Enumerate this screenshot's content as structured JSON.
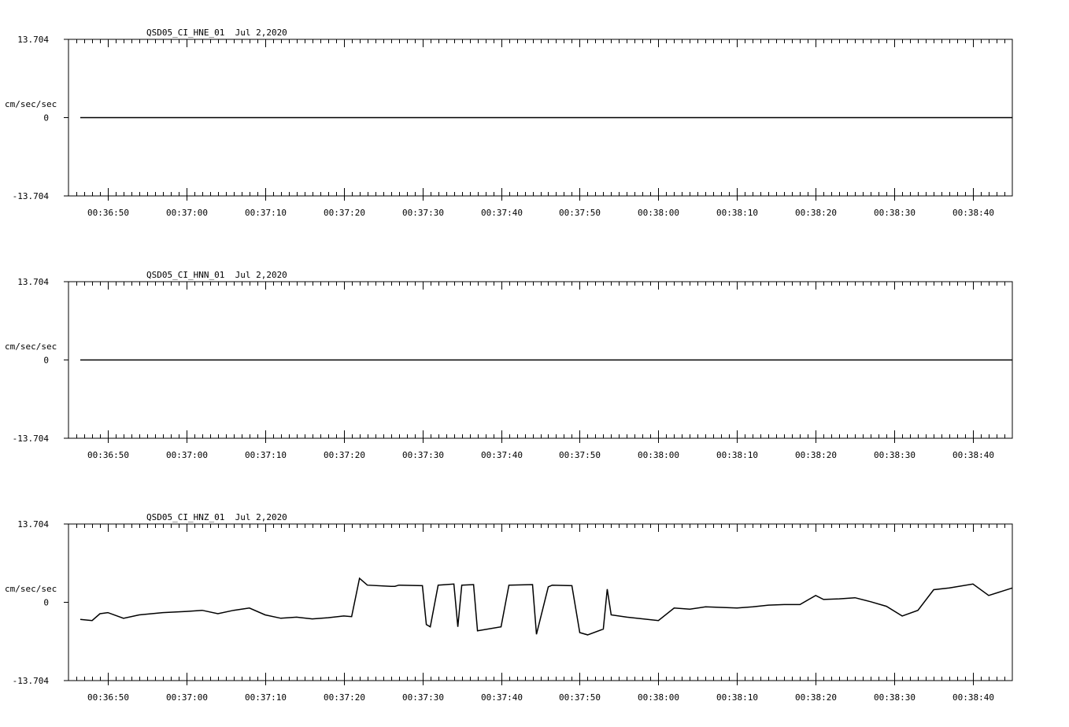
{
  "chart_data": [
    {
      "type": "line",
      "title": "QSD05_CI_HNE_01  Jul 2,2020",
      "ylabel": "cm/sec/sec",
      "ytick_labels": [
        "13.704",
        "0",
        "-13.704"
      ],
      "ylim": [
        -13.704,
        13.704
      ],
      "x_start": "00:36:45",
      "x_end": "00:38:45",
      "xtick_labels": [
        "00:36:50",
        "00:37:00",
        "00:37:10",
        "00:37:20",
        "00:37:30",
        "00:37:40",
        "00:37:50",
        "00:38:00",
        "00:38:10",
        "00:38:20",
        "00:38:30",
        "00:38:40"
      ],
      "series": [
        {
          "x": [
            "00:36:46.5",
            "00:38:45"
          ],
          "y": [
            0,
            0
          ]
        }
      ]
    },
    {
      "type": "line",
      "title": "QSD05_CI_HNN_01  Jul 2,2020",
      "ylabel": "cm/sec/sec",
      "ytick_labels": [
        "13.704",
        "0",
        "-13.704"
      ],
      "ylim": [
        -13.704,
        13.704
      ],
      "x_start": "00:36:45",
      "x_end": "00:38:45",
      "xtick_labels": [
        "00:36:50",
        "00:37:00",
        "00:37:10",
        "00:37:20",
        "00:37:30",
        "00:37:40",
        "00:37:50",
        "00:38:00",
        "00:38:10",
        "00:38:20",
        "00:38:30",
        "00:38:40"
      ],
      "series": [
        {
          "x": [
            "00:36:46.5",
            "00:38:45"
          ],
          "y": [
            0,
            0
          ]
        }
      ]
    },
    {
      "type": "line",
      "title": "QSD05_CI_HNZ_01  Jul 2,2020",
      "ylabel": "cm/sec/sec",
      "ytick_labels": [
        "13.704",
        "0",
        "-13.704"
      ],
      "ylim": [
        -13.704,
        13.704
      ],
      "x_start": "00:36:45",
      "x_end": "00:38:45",
      "xtick_labels": [
        "00:36:50",
        "00:37:00",
        "00:37:10",
        "00:37:20",
        "00:37:30",
        "00:37:40",
        "00:37:50",
        "00:38:00",
        "00:38:10",
        "00:38:20",
        "00:38:30",
        "00:38:40"
      ],
      "series": [
        {
          "x": [
            "00:36:46.5",
            "00:36:48",
            "00:36:49",
            "00:36:50",
            "00:36:52",
            "00:36:54",
            "00:36:57",
            "00:37:00",
            "00:37:02",
            "00:37:04",
            "00:37:06",
            "00:37:08",
            "00:37:10",
            "00:37:12",
            "00:37:14",
            "00:37:16",
            "00:37:18",
            "00:37:20",
            "00:37:21",
            "00:37:22",
            "00:37:23",
            "00:37:26",
            "00:37:26.5",
            "00:37:27",
            "00:37:30",
            "00:37:30.5",
            "00:37:31",
            "00:37:32",
            "00:37:34",
            "00:37:34.5",
            "00:37:35",
            "00:37:36.5",
            "00:37:37",
            "00:37:40",
            "00:37:41",
            "00:37:44",
            "00:37:44.5",
            "00:37:46",
            "00:37:46.5",
            "00:37:49",
            "00:37:50",
            "00:37:51",
            "00:37:53",
            "00:37:53.5",
            "00:37:54",
            "00:37:56",
            "00:38:00",
            "00:38:02",
            "00:38:04",
            "00:38:06",
            "00:38:08",
            "00:38:10",
            "00:38:12",
            "00:38:14",
            "00:38:16",
            "00:38:18",
            "00:38:20",
            "00:38:21",
            "00:38:23",
            "00:38:25",
            "00:38:27",
            "00:38:29",
            "00:38:31",
            "00:38:33",
            "00:38:35",
            "00:38:37",
            "00:38:40",
            "00:38:42",
            "00:38:45"
          ],
          "y": [
            -3,
            -3.2,
            -2,
            -1.8,
            -2.8,
            -2.2,
            -1.8,
            -1.6,
            -1.4,
            -2,
            -1.4,
            -1,
            -2.2,
            -2.8,
            -2.6,
            -2.9,
            -2.7,
            -2.4,
            -2.5,
            4.2,
            3,
            2.8,
            2.8,
            3,
            2.9,
            -3.9,
            -4.3,
            3,
            3.2,
            -4.3,
            3,
            3.1,
            -5,
            -4.3,
            3,
            3.1,
            -5.6,
            2.7,
            3,
            2.9,
            -5.3,
            -5.7,
            -4.7,
            2.3,
            -2.2,
            -2.6,
            -3.2,
            -1,
            -1.2,
            -0.8,
            -0.9,
            -1,
            -0.8,
            -0.5,
            -0.4,
            -0.4,
            1.2,
            0.5,
            0.6,
            0.8,
            0.1,
            -0.7,
            -2.4,
            -1.4,
            2.2,
            2.5,
            3.2,
            1.2,
            2.5
          ]
        }
      ]
    }
  ]
}
